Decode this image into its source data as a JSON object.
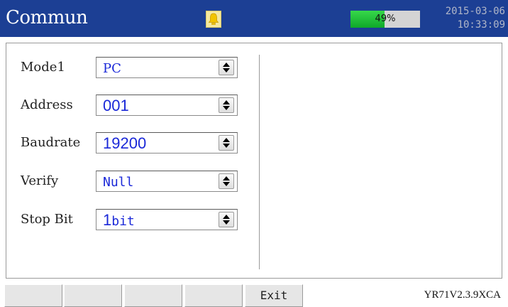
{
  "header": {
    "title": "Commun",
    "alarm_icon": "bell-icon",
    "progress": {
      "value": 0.49,
      "label": "49%"
    },
    "date": "2015-03-06",
    "time": "10:33:09"
  },
  "settings": [
    {
      "label": "Mode1",
      "value": "PC"
    },
    {
      "label": "Address",
      "value": "001"
    },
    {
      "label": "Baudrate",
      "value": "19200"
    },
    {
      "label": "Verify",
      "value": "Null"
    },
    {
      "label": "Stop Bit",
      "value_num": "1",
      "value_unit": "bit"
    }
  ],
  "footer": {
    "buttons": [
      "",
      "",
      "",
      "",
      "Exit"
    ],
    "version": "YR71V2.3.9XCA"
  },
  "colors": {
    "header_bg": "#1c3f94",
    "value_text": "#1a28d8",
    "progress_fill": "#1fc23a"
  }
}
